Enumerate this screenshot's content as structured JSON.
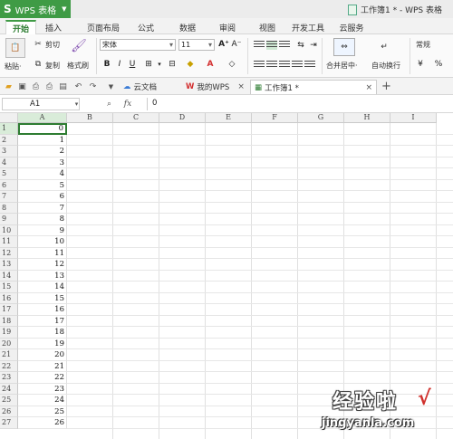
{
  "app": {
    "name": "WPS 表格",
    "window_title": "工作簿1 * - WPS 表格"
  },
  "ribbon_tabs": [
    {
      "label": "开始",
      "active": true
    },
    {
      "label": "插入"
    },
    {
      "label": "页面布局"
    },
    {
      "label": "公式"
    },
    {
      "label": "数据"
    },
    {
      "label": "审阅"
    },
    {
      "label": "视图"
    },
    {
      "label": "开发工具"
    },
    {
      "label": "云服务"
    }
  ],
  "ribbon": {
    "paste_label": "粘贴·",
    "cut_label": "剪切",
    "copy_label": "复制",
    "format_painter_label": "格式刷",
    "font_name": "宋体",
    "font_size": "11",
    "merge_center_label": "合并居中·",
    "wrap_text_label": "自动换行",
    "number_format": "常规",
    "percent_symbol": "%"
  },
  "doc_tabs": [
    {
      "label": "云文档"
    },
    {
      "label": "我的WPS"
    },
    {
      "label": "工作簿1 *",
      "active": true
    }
  ],
  "formula_bar": {
    "name_box": "A1",
    "fx_label": "fx",
    "value": "0"
  },
  "columns": [
    "A",
    "B",
    "C",
    "D",
    "E",
    "F",
    "G",
    "H",
    "I"
  ],
  "rows": [
    {
      "n": "1",
      "a": "0"
    },
    {
      "n": "2",
      "a": "1"
    },
    {
      "n": "3",
      "a": "2"
    },
    {
      "n": "4",
      "a": "3"
    },
    {
      "n": "5",
      "a": "4"
    },
    {
      "n": "6",
      "a": "5"
    },
    {
      "n": "7",
      "a": "6"
    },
    {
      "n": "8",
      "a": "7"
    },
    {
      "n": "9",
      "a": "8"
    },
    {
      "n": "10",
      "a": "9"
    },
    {
      "n": "11",
      "a": "10"
    },
    {
      "n": "12",
      "a": "11"
    },
    {
      "n": "13",
      "a": "12"
    },
    {
      "n": "14",
      "a": "13"
    },
    {
      "n": "15",
      "a": "14"
    },
    {
      "n": "16",
      "a": "15"
    },
    {
      "n": "17",
      "a": "16"
    },
    {
      "n": "18",
      "a": "17"
    },
    {
      "n": "19",
      "a": "18"
    },
    {
      "n": "20",
      "a": "19"
    },
    {
      "n": "21",
      "a": "20"
    },
    {
      "n": "22",
      "a": "21"
    },
    {
      "n": "23",
      "a": "22"
    },
    {
      "n": "24",
      "a": "23"
    },
    {
      "n": "25",
      "a": "24"
    },
    {
      "n": "26",
      "a": "25"
    },
    {
      "n": "27",
      "a": "26"
    }
  ],
  "watermark": {
    "text": "经验啦",
    "check": "√",
    "sub": "jingyanla.com"
  },
  "colors": {
    "accent": "#3f9b45",
    "active_cell": "#2e7d32"
  }
}
